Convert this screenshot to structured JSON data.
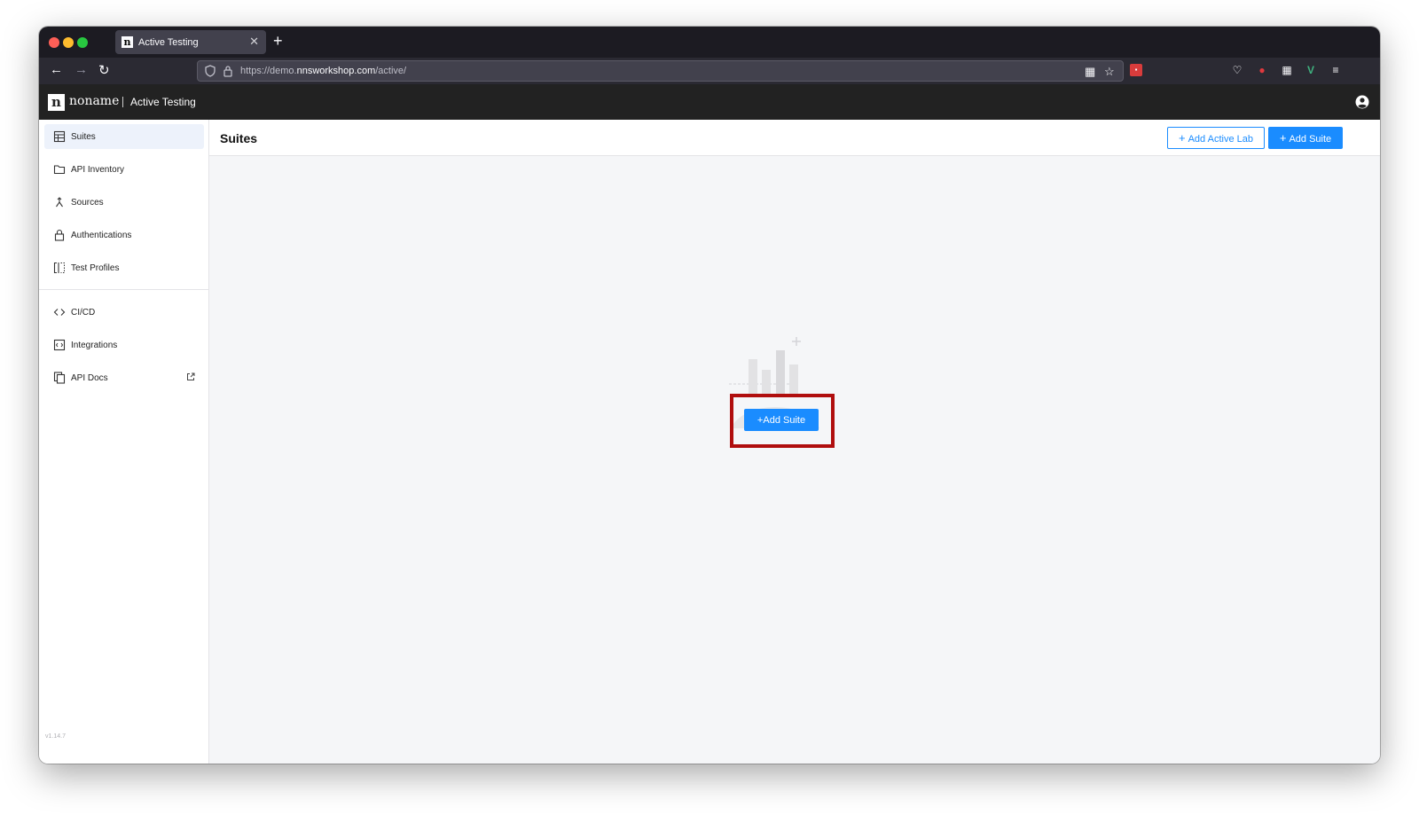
{
  "browser": {
    "tab_title": "Active Testing",
    "tab_favicon": "n",
    "url_prefix": "https://demo.",
    "url_host": "nnsworkshop.com",
    "url_path": "/active/"
  },
  "app": {
    "logo_letter": "n",
    "brand": "noname",
    "product": "Active Testing"
  },
  "sidebar": {
    "items": [
      {
        "label": "Suites",
        "icon": "suites-icon"
      },
      {
        "label": "API Inventory",
        "icon": "folder-icon"
      },
      {
        "label": "Sources",
        "icon": "merge-icon"
      },
      {
        "label": "Authentications",
        "icon": "lock-icon"
      },
      {
        "label": "Test Profiles",
        "icon": "profiles-icon"
      },
      {
        "label": "CI/CD",
        "icon": "code-icon"
      },
      {
        "label": "Integrations",
        "icon": "integrations-icon"
      },
      {
        "label": "API Docs",
        "icon": "docs-icon"
      }
    ],
    "version": "v1.14.7"
  },
  "main": {
    "title": "Suites",
    "add_active_lab_label": "Add Active Lab",
    "add_suite_label": "Add Suite",
    "empty_add_suite_label": "Add Suite"
  },
  "colors": {
    "accent": "#1a8cff",
    "highlight": "#b00e0e",
    "header_bg": "#222222"
  }
}
